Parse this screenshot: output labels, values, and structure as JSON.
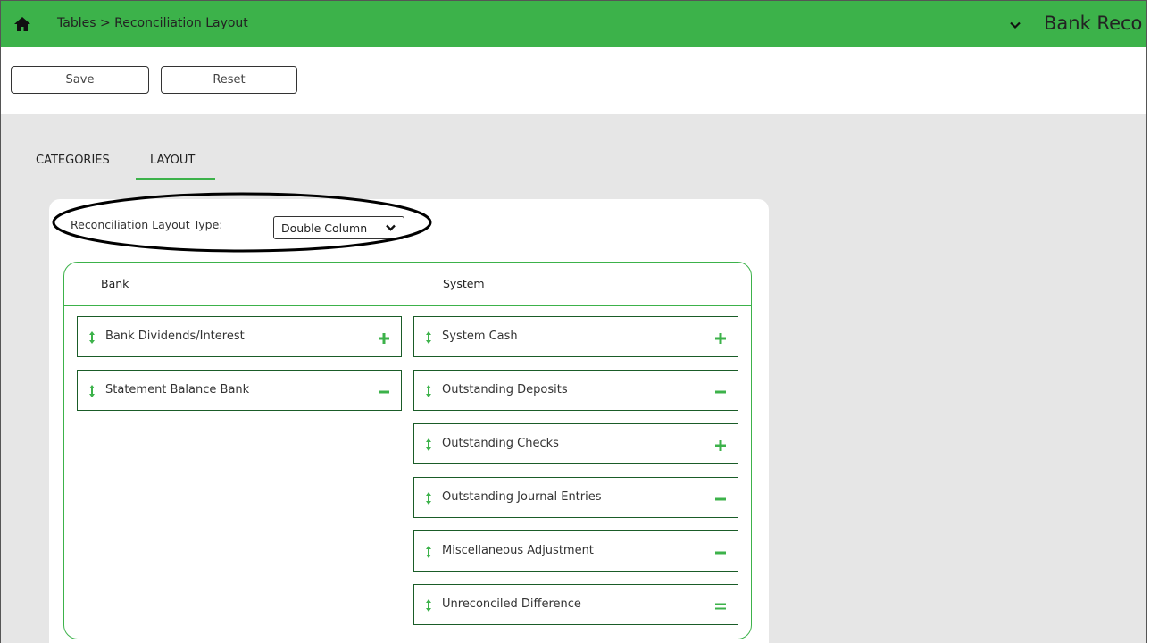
{
  "header": {
    "breadcrumb": "Tables > Reconciliation Layout",
    "app_title": "Bank Reco",
    "home_icon": "home-icon",
    "menu_icon": "chevron-down-icon"
  },
  "toolbar": {
    "save_label": "Save",
    "reset_label": "Reset"
  },
  "tabs": [
    {
      "label": "CATEGORIES",
      "active": false
    },
    {
      "label": "LAYOUT",
      "active": true
    }
  ],
  "layout_type": {
    "label": "Reconciliation Layout Type:",
    "value": "Double Column"
  },
  "columns": {
    "bank": "Bank",
    "system": "System"
  },
  "bank_items": [
    {
      "label": "Bank Dividends/Interest",
      "op": "plus"
    },
    {
      "label": "Statement Balance Bank",
      "op": "minus"
    }
  ],
  "system_items": [
    {
      "label": "System Cash",
      "op": "plus"
    },
    {
      "label": "Outstanding Deposits",
      "op": "minus"
    },
    {
      "label": "Outstanding Checks",
      "op": "plus"
    },
    {
      "label": "Outstanding Journal Entries",
      "op": "minus"
    },
    {
      "label": "Miscellaneous Adjustment",
      "op": "minus"
    },
    {
      "label": "Unreconciled Difference",
      "op": "equals"
    }
  ],
  "colors": {
    "accent": "#3cb24a",
    "item_border": "#1a5c28",
    "background": "#e6e6e6"
  }
}
